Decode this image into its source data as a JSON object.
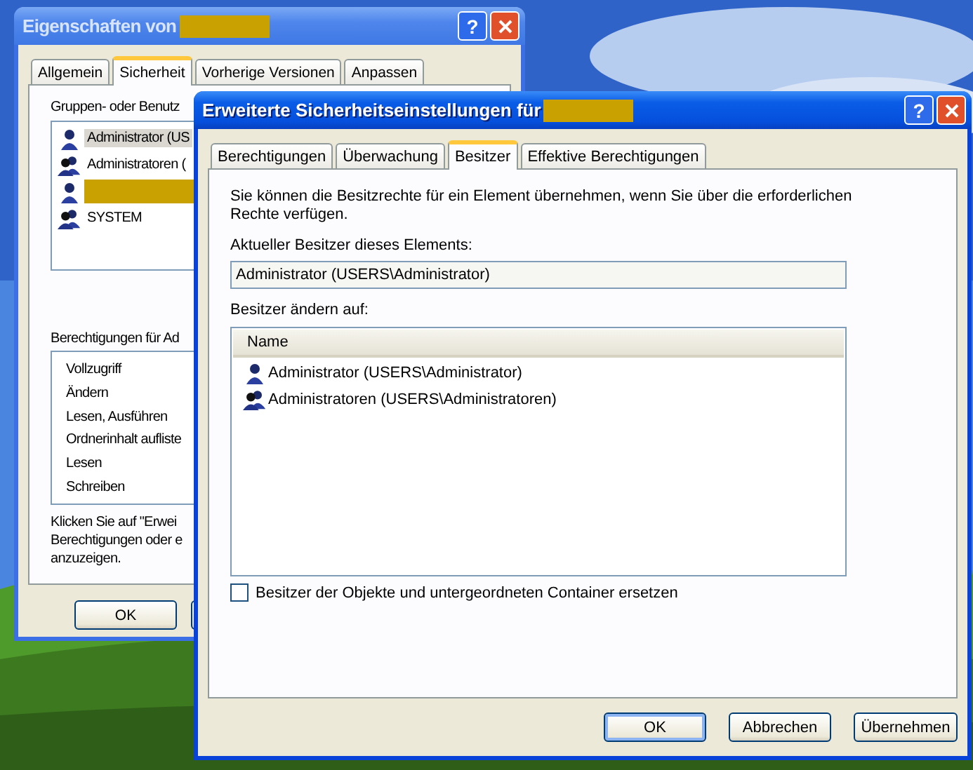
{
  "back_window": {
    "title": "Eigenschaften von",
    "title_redacted": true,
    "title_buttons": [
      "?"
    ],
    "tabs": [
      {
        "label": "Allgemein",
        "selected": false
      },
      {
        "label": "Sicherheit",
        "selected": true
      },
      {
        "label": "Vorherige Versionen",
        "selected": false
      },
      {
        "label": "Anpassen",
        "selected": false
      }
    ],
    "users_label": "Gruppen- oder Benutz",
    "users": [
      {
        "name": "Administrator (US",
        "kind": "user",
        "selected": true,
        "redacted": false
      },
      {
        "name": "Administratoren (",
        "kind": "group",
        "selected": false,
        "redacted": false
      },
      {
        "kind": "user",
        "selected": false,
        "redacted": true
      },
      {
        "name": "SYSTEM",
        "kind": "group",
        "selected": false,
        "redacted": false
      }
    ],
    "permissions_label": "Berechtigungen für Ad",
    "permissions": [
      "Vollzugriff",
      "Ändern",
      "Lesen, Ausführen",
      "Ordnerinhalt aufliste",
      "Lesen",
      "Schreiben"
    ],
    "hint_lines": [
      "Klicken Sie auf \"Erwei",
      "Berechtigungen oder e",
      "anzuzeigen."
    ],
    "buttons": [
      "OK"
    ]
  },
  "front_window": {
    "title": "Erweiterte Sicherheitseinstellungen für",
    "title_redacted": true,
    "title_buttons": [
      "?"
    ],
    "tabs": [
      {
        "label": "Berechtigungen",
        "selected": false
      },
      {
        "label": "Überwachung",
        "selected": false
      },
      {
        "label": "Besitzer",
        "selected": true
      },
      {
        "label": "Effektive Berechtigungen",
        "selected": false
      }
    ],
    "intro": "Sie können die Besitzrechte für ein Element übernehmen, wenn Sie über die erforderlichen Rechte verfügen.",
    "current_owner_label": "Aktueller Besitzer dieses Elements:",
    "current_owner": "Administrator (USERS\\Administrator)",
    "change_label": "Besitzer ändern auf:",
    "columns": [
      "Name"
    ],
    "owners": [
      {
        "name": "Administrator (USERS\\Administrator)",
        "kind": "user"
      },
      {
        "name": "Administratoren (USERS\\Administratoren)",
        "kind": "group"
      }
    ],
    "replace_checkbox": {
      "label": "Besitzer der Objekte und untergeordneten Container ersetzen",
      "checked": false
    },
    "buttons": [
      {
        "label": "OK",
        "default": true
      },
      {
        "label": "Abbrechen",
        "default": false
      },
      {
        "label": "Übernehmen",
        "default": false
      }
    ]
  }
}
